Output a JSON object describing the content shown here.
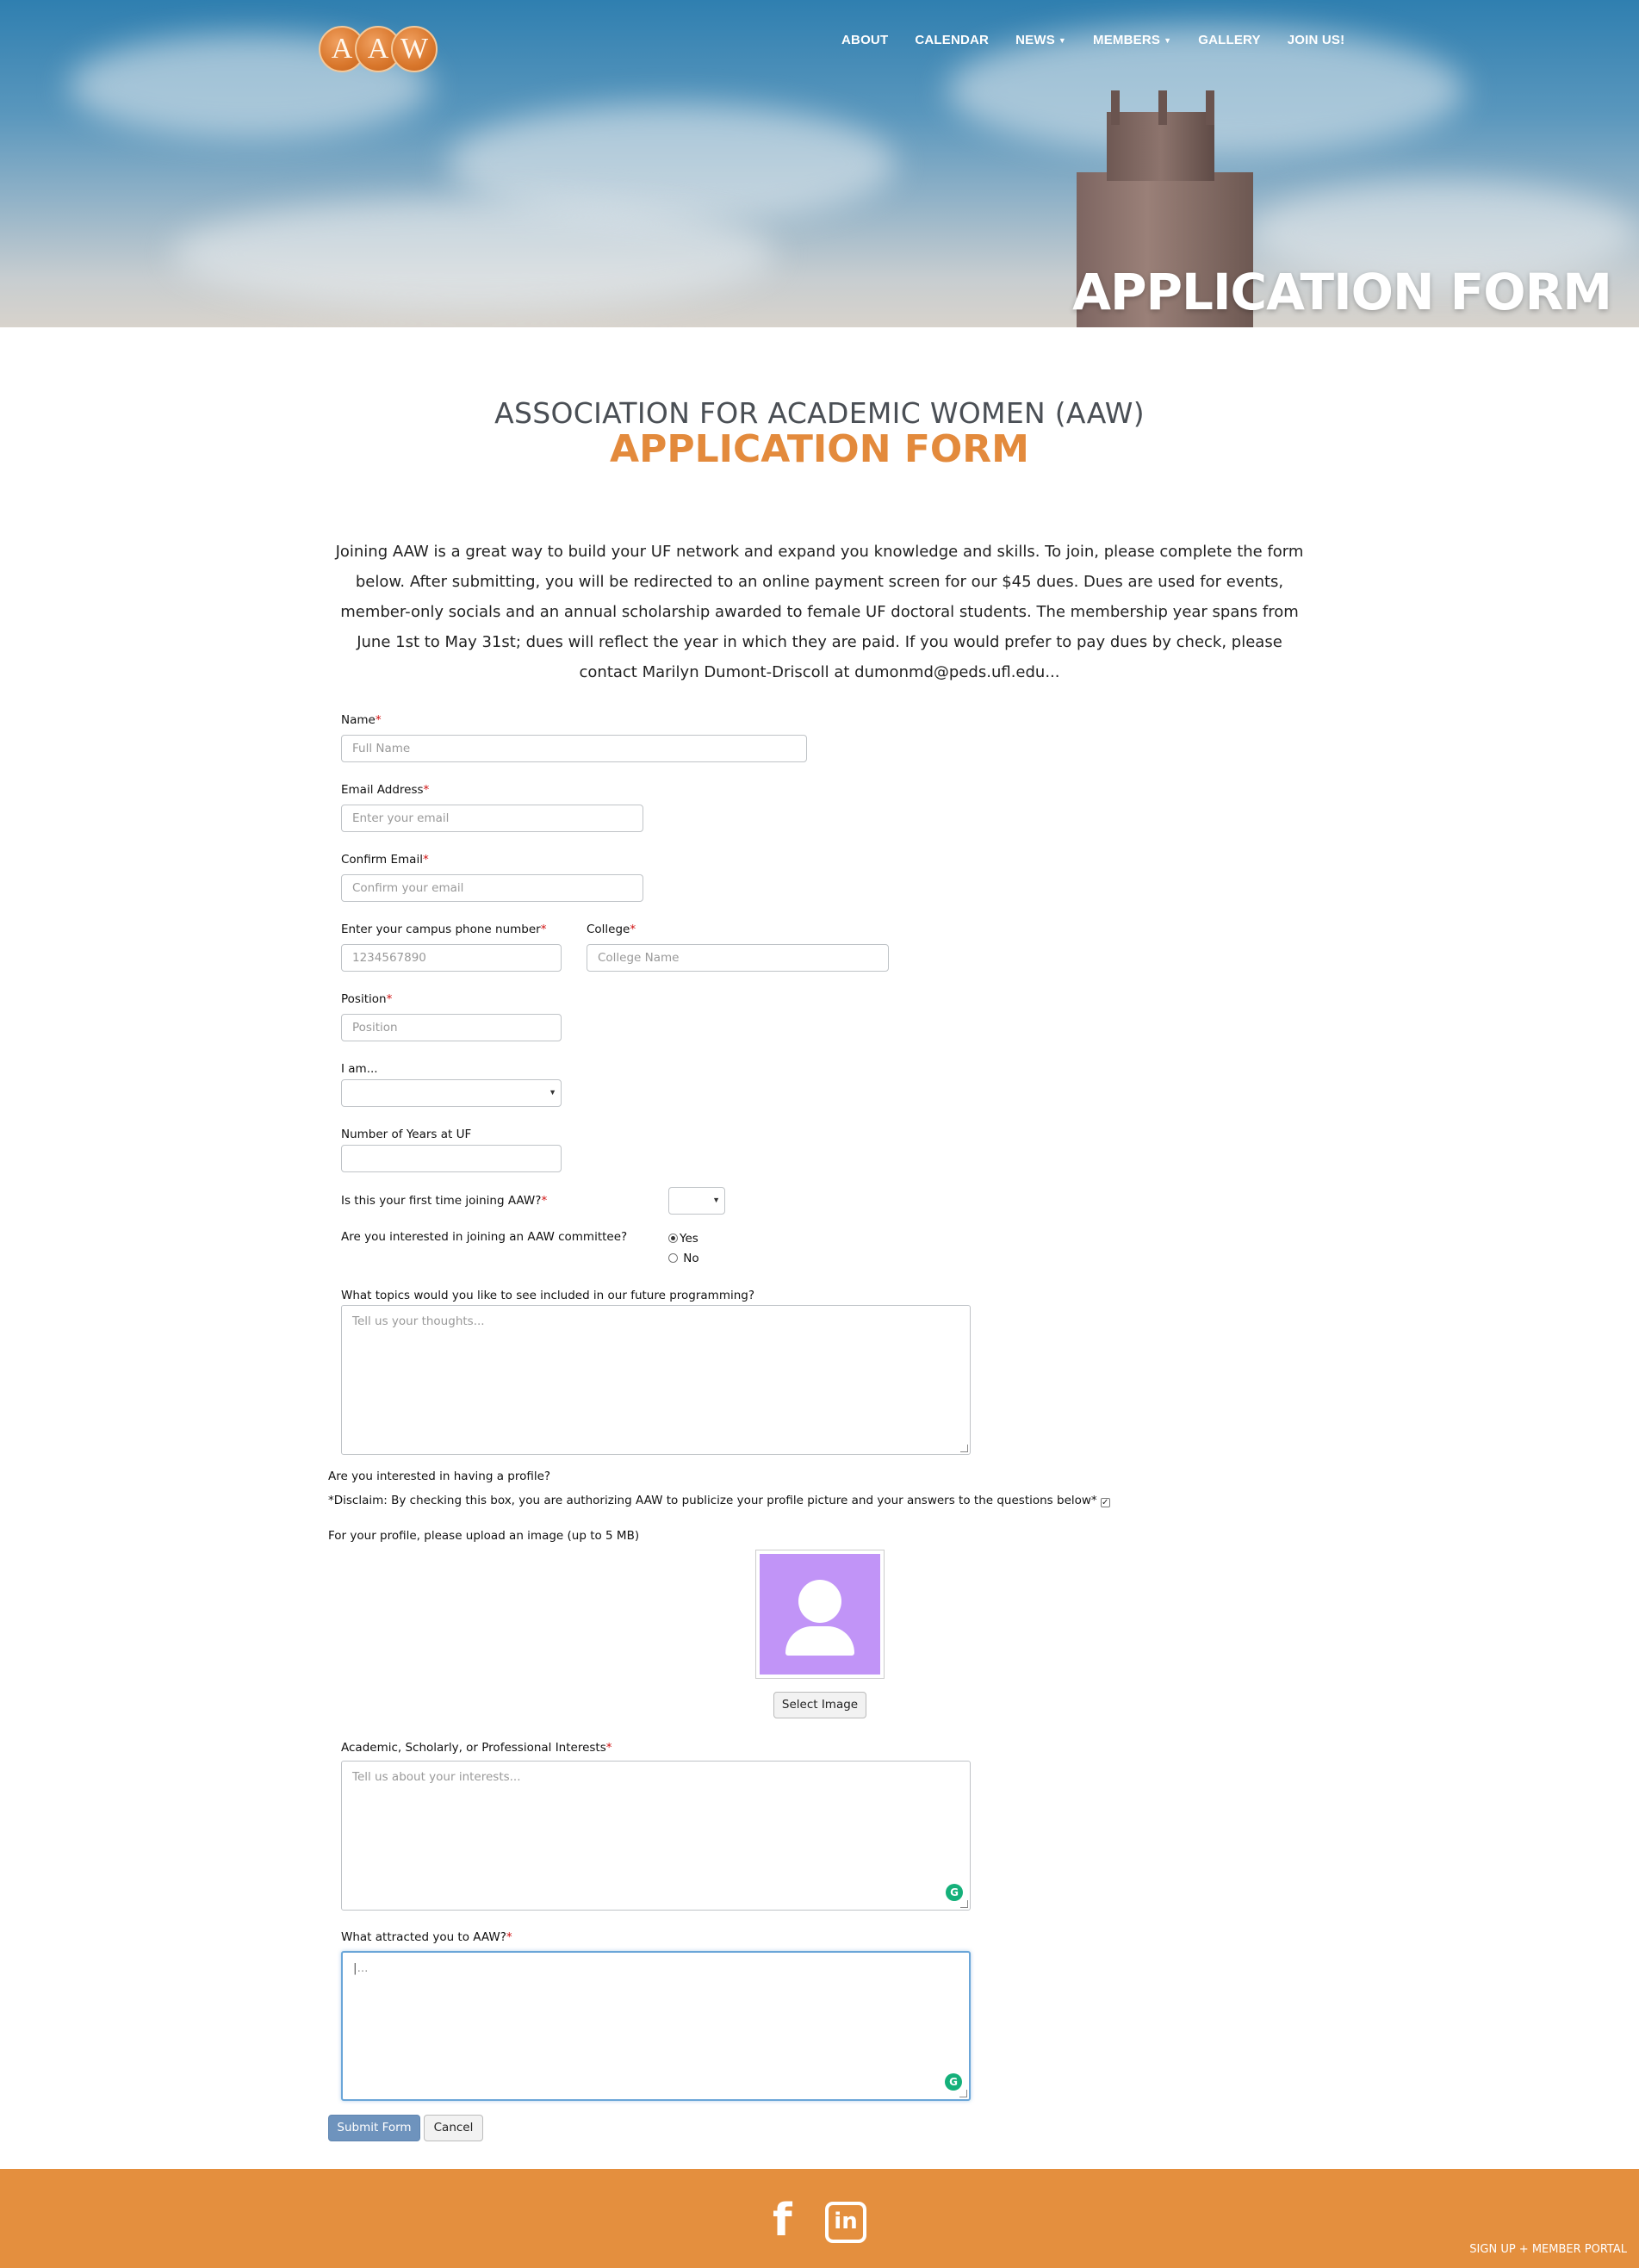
{
  "brand": {
    "logo_letters": [
      "A",
      "A",
      "W"
    ],
    "accent": "#e38a3c"
  },
  "nav": {
    "items": [
      {
        "label": "ABOUT"
      },
      {
        "label": "CALENDAR"
      },
      {
        "label": "NEWS",
        "dropdown": true
      },
      {
        "label": "MEMBERS",
        "dropdown": true
      },
      {
        "label": "GALLERY"
      },
      {
        "label": "JOIN US!"
      }
    ]
  },
  "hero": {
    "title": "APPLICATION FORM"
  },
  "page": {
    "org_title": "ASSOCIATION FOR ACADEMIC WOMEN (AAW)",
    "form_title": "APPLICATION FORM",
    "intro": "Joining AAW is a great way to build your UF network and expand you knowledge and skills. To join, please complete the form below. After submitting, you will be redirected to an online payment screen for our $45 dues. Dues are used for events, member-only socials and an annual scholarship awarded to female UF doctoral students. The membership year spans from June 1st to May 31st; dues will reflect the year in which they are paid. If you would prefer to pay dues by check, please contact Marilyn Dumont-Driscoll at dumonmd@peds.ufl.edu..."
  },
  "form": {
    "name": {
      "label": "Name",
      "required_mark": "*",
      "placeholder": "Full Name"
    },
    "email": {
      "label": "Email Address",
      "required_mark": "*",
      "placeholder": "Enter your email"
    },
    "confirm_email": {
      "label": "Confirm Email",
      "required_mark": "*",
      "placeholder": "Confirm your email"
    },
    "phone": {
      "label": "Enter your campus phone number",
      "required_mark": "*",
      "placeholder": "1234567890"
    },
    "college": {
      "label": "College",
      "required_mark": "*",
      "placeholder": "College Name"
    },
    "position": {
      "label": "Position",
      "required_mark": "*",
      "placeholder": "Position"
    },
    "i_am": {
      "label": "I am...",
      "value": ""
    },
    "years": {
      "label": "Number of Years at UF",
      "value": ""
    },
    "first_time": {
      "label": "Is this your first time joining AAW?",
      "required_mark": "*",
      "value": ""
    },
    "committee": {
      "label": "Are you interested in joining an AAW committee?",
      "options": [
        "Yes",
        "No"
      ],
      "selected": "Yes"
    },
    "topics": {
      "label": "What topics would you like to see included in our future programming?",
      "placeholder": "Tell us your thoughts..."
    },
    "profile": {
      "question": "Are you interested in having a profile?",
      "disclaimer": "*Disclaim: By checking this box, you are authorizing AAW to publicize your profile picture and your answers to the questions below*",
      "checked": true,
      "upload_label": "For your profile, please upload an image (up to 5 MB)",
      "select_button": "Select Image"
    },
    "interests": {
      "label": "Academic, Scholarly, or Professional Interests",
      "required_mark": "*",
      "placeholder": "Tell us about your interests..."
    },
    "attracted": {
      "label": "What attracted you to AAW?",
      "required_mark": "*",
      "placeholder": "..."
    },
    "submit_label": "Submit Form",
    "cancel_label": "Cancel",
    "grammarly_glyph": "G"
  },
  "footer": {
    "social": [
      {
        "icon": "facebook-icon",
        "glyph": "f"
      },
      {
        "icon": "linkedin-icon",
        "glyph": "in"
      }
    ],
    "link_text": "SIGN UP + MEMBER PORTAL",
    "background": "#e48f3e"
  }
}
